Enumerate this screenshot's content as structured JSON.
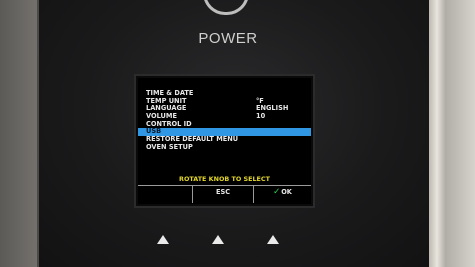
{
  "device": {
    "power_label": "POWER"
  },
  "screen": {
    "menu": [
      {
        "label": "TIME & DATE",
        "value": ""
      },
      {
        "label": "TEMP UNIT",
        "value": "°F"
      },
      {
        "label": "LANGUAGE",
        "value": "ENGLISH"
      },
      {
        "label": "VOLUME",
        "value": "10"
      },
      {
        "label": "CONTROL ID",
        "value": ""
      },
      {
        "label": "USB",
        "value": ""
      },
      {
        "label": "RESTORE DEFAULT MENU",
        "value": ""
      },
      {
        "label": "OVEN SETUP",
        "value": ""
      }
    ],
    "selected_item": "USB",
    "prompt": "ROTATE KNOB TO SELECT",
    "softkeys": {
      "left": "",
      "middle": "ESC",
      "right": "OK"
    }
  },
  "colors": {
    "highlight": "#2f97e3",
    "prompt": "#e2d62b",
    "check": "#34d84a"
  },
  "icons": {
    "ok_check": "check-icon",
    "nav_buttons": [
      "up-arrow-icon",
      "up-arrow-icon",
      "up-arrow-icon"
    ]
  }
}
